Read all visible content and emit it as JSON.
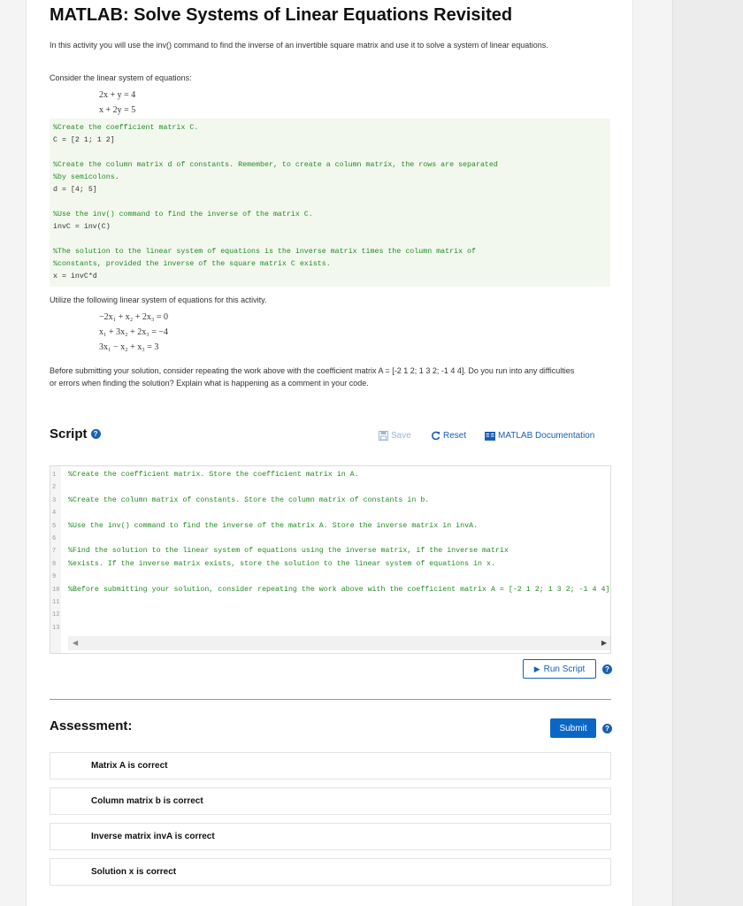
{
  "title": "MATLAB: Solve Systems of Linear Equations Revisited",
  "intro": "In this activity you will use the inv() command to find the inverse of an invertible square matrix and use it to solve a system of linear equations.",
  "consider": "Consider the linear system of equations:",
  "example_equations": [
    "2x + y = 4",
    "x + 2y = 5"
  ],
  "example_code": [
    {
      "text": "%Create the coefficient matrix C.",
      "comment": true
    },
    {
      "text": "C = [2 1; 1 2]",
      "comment": false
    },
    {
      "text": "",
      "comment": false
    },
    {
      "text": "%Create the column matrix d of constants.  Remember, to create a column matrix, the rows are separated",
      "comment": true
    },
    {
      "text": "%by semicolons.",
      "comment": true
    },
    {
      "text": "d = [4; 5]",
      "comment": false
    },
    {
      "text": "",
      "comment": false
    },
    {
      "text": "%Use the inv() command to find the inverse of the matrix C.",
      "comment": true
    },
    {
      "text": "invC = inv(C)",
      "comment": false
    },
    {
      "text": "",
      "comment": false
    },
    {
      "text": "%The solution to the linear system of equations is the inverse matrix times the column matrix of",
      "comment": true
    },
    {
      "text": "%constants, provided the inverse of the square matrix C exists.",
      "comment": true
    },
    {
      "text": "x = invC*d",
      "comment": false
    }
  ],
  "utilize": "Utilize the following linear system of equations for this activity.",
  "activity_equations": [
    "−2x₁ + x₂ + 2x₃ = 0",
    "x₁ + 3x₂ + 2x₃ = −4",
    "3x₁ − x₂ + x₃ = 3"
  ],
  "before_submit": "Before submitting your solution, consider repeating the work above with the coefficient matrix A = [-2 1 2; 1 3 2; -1 4 4].  Do you run into any difficulties or errors when finding the solution? Explain what is happening as a comment in your code.",
  "script": {
    "heading": "Script",
    "save_label": "Save",
    "reset_label": "Reset",
    "docs_label": "MATLAB Documentation",
    "run_label": "Run Script",
    "lines": [
      {
        "n": "1",
        "text": "%Create the coefficient matrix.  Store the coefficient matrix in A."
      },
      {
        "n": "2",
        "text": ""
      },
      {
        "n": "3",
        "text": "%Create the column matrix of constants.  Store the column matrix of constants in b."
      },
      {
        "n": "4",
        "text": ""
      },
      {
        "n": "5",
        "text": "%Use the inv() command to find the inverse of the matrix A.  Store the inverse matrix in invA."
      },
      {
        "n": "6",
        "text": ""
      },
      {
        "n": "7",
        "text": "%Find the solution to the linear system of equations using the inverse matrix, if the inverse matrix"
      },
      {
        "n": "8",
        "text": "%exists.  If the inverse matrix exists, store the solution to the linear system of equations in x."
      },
      {
        "n": "9",
        "text": ""
      },
      {
        "n": "10",
        "text": "%Before submitting your solution, consider repeating the work above with the coefficient matrix A = [-2 1 2; 1 3 2; -1 4 4]"
      },
      {
        "n": "11",
        "text": ""
      },
      {
        "n": "12",
        "text": ""
      },
      {
        "n": "13",
        "text": ""
      }
    ]
  },
  "assessment": {
    "heading": "Assessment:",
    "submit_label": "Submit",
    "items": [
      "Matrix A is correct",
      "Column matrix b is correct",
      "Inverse matrix invA is correct",
      "Solution x is correct"
    ]
  },
  "colors": {
    "accent": "#1a5fb4",
    "code_bg": "#f3f8ef",
    "comment": "#228b22",
    "submit_bg": "#0b67c6"
  },
  "icons": [
    "save-icon",
    "reset-icon",
    "documentation-icon",
    "play-icon",
    "help-icon",
    "scroll-left-icon",
    "scroll-right-icon"
  ]
}
